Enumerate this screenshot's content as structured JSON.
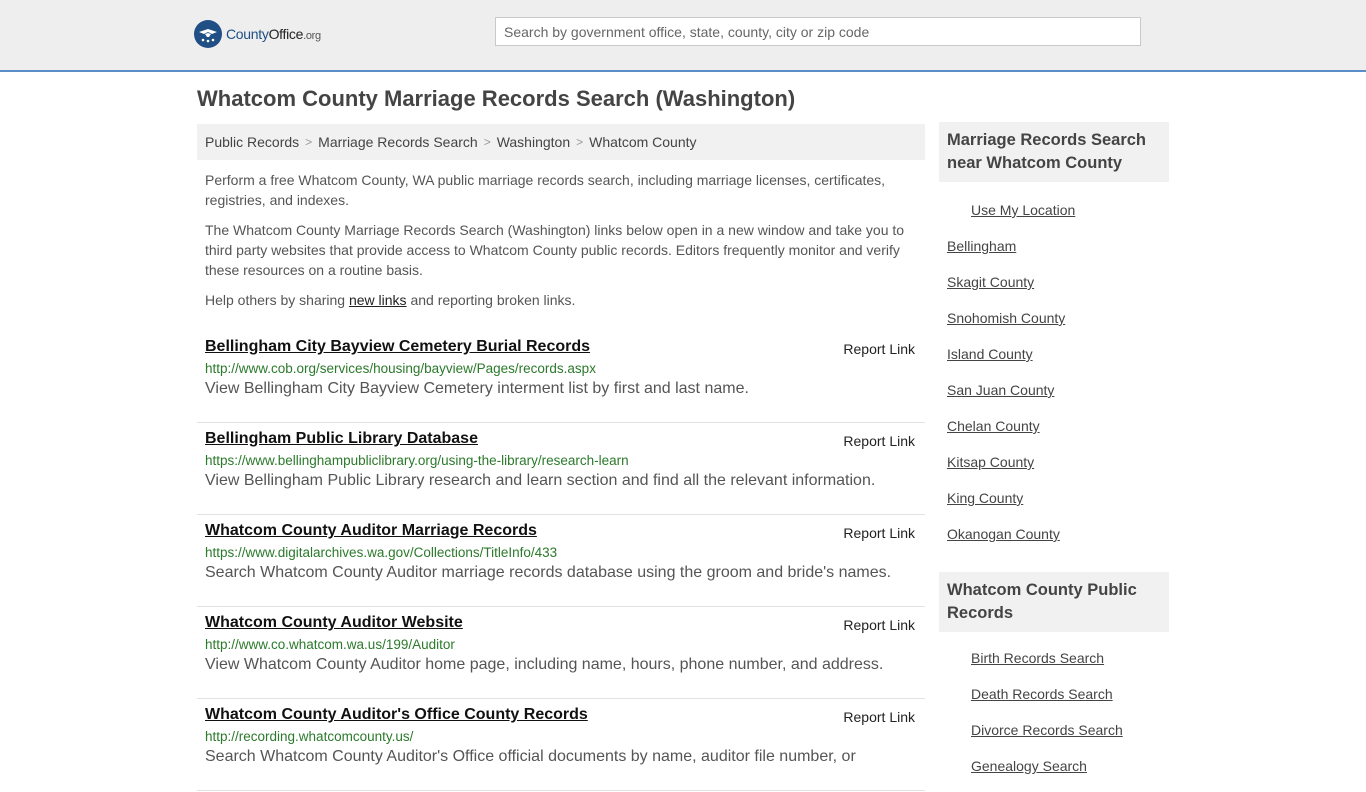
{
  "header": {
    "logo": {
      "brand": "County",
      "office": "Office",
      "suffix": ".org"
    },
    "search_placeholder": "Search by government office, state, county, city or zip code"
  },
  "page_title": "Whatcom County Marriage Records Search (Washington)",
  "breadcrumb": [
    "Public Records",
    "Marriage Records Search",
    "Washington",
    "Whatcom County"
  ],
  "intro": {
    "p1": "Perform a free Whatcom County, WA public marriage records search, including marriage licenses, certificates, registries, and indexes.",
    "p2": "The Whatcom County Marriage Records Search (Washington) links below open in a new window and take you to third party websites that provide access to Whatcom County public records. Editors frequently monitor and verify these resources on a routine basis.",
    "p3_before": "Help others by sharing ",
    "p3_link": "new links",
    "p3_after": " and reporting broken links."
  },
  "report_label": "Report Link",
  "results": [
    {
      "title": "Bellingham City Bayview Cemetery Burial Records",
      "url": "http://www.cob.org/services/housing/bayview/Pages/records.aspx",
      "desc": "View Bellingham City Bayview Cemetery interment list by first and last name."
    },
    {
      "title": "Bellingham Public Library Database",
      "url": "https://www.bellinghampubliclibrary.org/using-the-library/research-learn",
      "desc": "View Bellingham Public Library research and learn section and find all the relevant information."
    },
    {
      "title": "Whatcom County Auditor Marriage Records",
      "url": "https://www.digitalarchives.wa.gov/Collections/TitleInfo/433",
      "desc": "Search Whatcom County Auditor marriage records database using the groom and bride's names."
    },
    {
      "title": "Whatcom County Auditor Website",
      "url": "http://www.co.whatcom.wa.us/199/Auditor",
      "desc": "View Whatcom County Auditor home page, including name, hours, phone number, and address."
    },
    {
      "title": "Whatcom County Auditor's Office County Records",
      "url": "http://recording.whatcomcounty.us/",
      "desc": "Search Whatcom County Auditor's Office official documents by name, auditor file number, or"
    }
  ],
  "sidebar": {
    "nearby_heading": "Marriage Records Search near Whatcom County",
    "use_location": "Use My Location",
    "nearby": [
      "Bellingham",
      "Skagit County",
      "Snohomish County",
      "Island County",
      "San Juan County",
      "Chelan County",
      "Kitsap County",
      "King County",
      "Okanogan County"
    ],
    "public_heading": "Whatcom County Public Records",
    "public": [
      "Birth Records Search",
      "Death Records Search",
      "Divorce Records Search",
      "Genealogy Search"
    ]
  }
}
